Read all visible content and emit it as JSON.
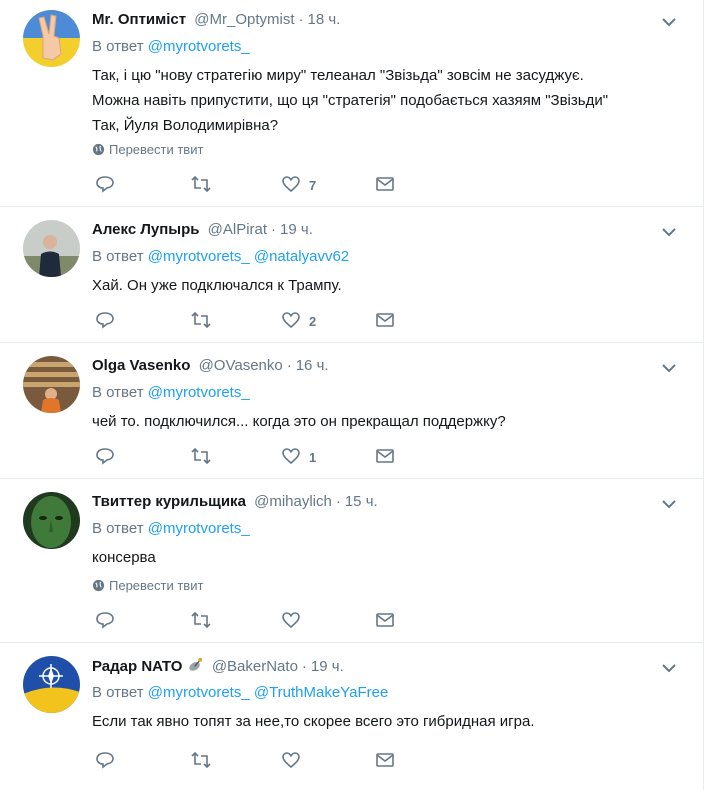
{
  "tweets": [
    {
      "name": "Mr. Оптиміст",
      "handle": "@Mr_Optymist",
      "time": "18 ч.",
      "reply_label": "В ответ",
      "mentions": [
        "@myrotvorets_"
      ],
      "text": "Так, і цю \"нову стратегію миру\" телеанал \"Звізьда\" зовсім не засуджує.\nМожна навіть припустити, що ця \"стратегія\" подобається хазяям \"Звізьди\"\nТак, Йуля Володимирівна?",
      "translate": "Перевести твит",
      "likes": "7",
      "avatar_icon": "peace-hand-avatar"
    },
    {
      "name": "Алекс Лупырь",
      "handle": "@AlPirat",
      "time": "19 ч.",
      "reply_label": "В ответ",
      "mentions": [
        "@myrotvorets_",
        "@natalyavv62"
      ],
      "text": "Хай. Он уже подключался к Трампу.",
      "translate": "",
      "likes": "2",
      "avatar_icon": "man-portrait-avatar"
    },
    {
      "name": "Olga Vasenko",
      "handle": "@OVasenko",
      "time": "16 ч.",
      "reply_label": "В ответ",
      "mentions": [
        "@myrotvorets_"
      ],
      "text": "чей то. подключился... когда это он прекращал поддержку?",
      "translate": "",
      "likes": "1",
      "avatar_icon": "woman-portrait-avatar"
    },
    {
      "name": "Твиттер курильщика",
      "handle": "@mihaylich",
      "time": "15 ч.",
      "reply_label": "В ответ",
      "mentions": [
        "@myrotvorets_"
      ],
      "text": "консерва",
      "translate": "Перевести твит",
      "likes": "",
      "avatar_icon": "green-face-avatar"
    },
    {
      "name": "Радар NATO",
      "handle": "@BakerNato",
      "time": "19 ч.",
      "reply_label": "В ответ",
      "mentions": [
        "@myrotvorets_",
        "@TruthMakeYaFree"
      ],
      "text": "Если так явно топят за нее,то скорее всего это гибридная игра.",
      "translate": "",
      "likes": "",
      "avatar_icon": "nato-flag-avatar"
    }
  ],
  "colors": {
    "accent": "#1da1f2",
    "muted": "#657786",
    "border": "#e6ecf0"
  }
}
